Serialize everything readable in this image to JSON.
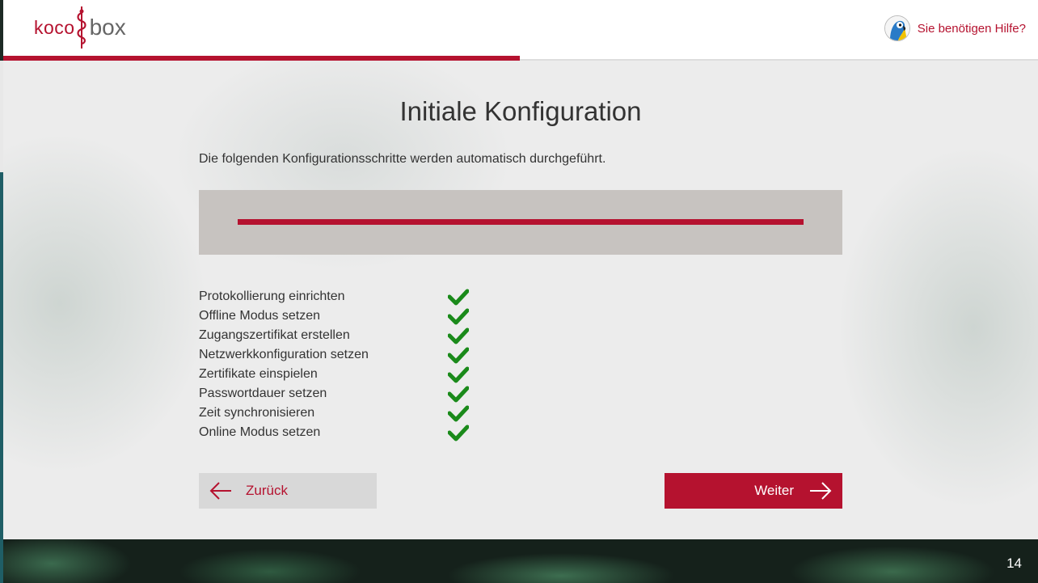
{
  "header": {
    "logo_left": "koco",
    "logo_right": "box",
    "help_label": "Sie benötigen Hilfe?"
  },
  "main": {
    "title": "Initiale Konfiguration",
    "intro": "Die folgenden Konfigurationsschritte werden automatisch durchgeführt.",
    "progress": 1.0,
    "steps": [
      {
        "label": "Protokollierung einrichten",
        "done": true
      },
      {
        "label": "Offline Modus setzen",
        "done": true
      },
      {
        "label": "Zugangszertifikat erstellen",
        "done": true
      },
      {
        "label": "Netzwerkkonfiguration setzen",
        "done": true
      },
      {
        "label": "Zertifikate einspielen",
        "done": true
      },
      {
        "label": "Passwortdauer setzen",
        "done": true
      },
      {
        "label": "Zeit synchronisieren",
        "done": true
      },
      {
        "label": "Online Modus setzen",
        "done": true
      }
    ],
    "back_label": "Zurück",
    "next_label": "Weiter"
  },
  "footer": {
    "page_number": "14"
  },
  "colors": {
    "accent": "#b5122f",
    "check": "#1a8a1a",
    "progress_bg": "#c7c3c0"
  },
  "icons": {
    "back": "arrow-left-icon",
    "next": "arrow-right-icon",
    "step_done": "checkmark-icon",
    "help": "parrot-avatar-icon"
  }
}
